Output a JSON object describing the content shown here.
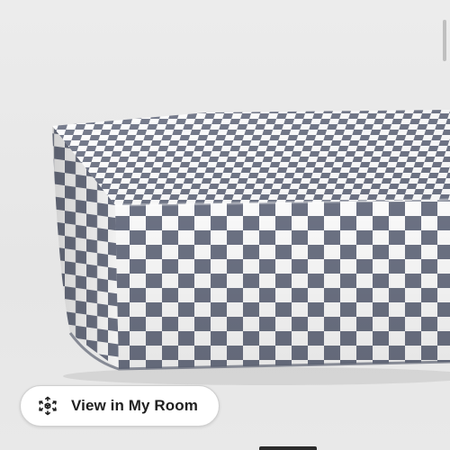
{
  "product": {
    "image_subject": "crib-mattress-fitted-sheet",
    "pattern": "checkerboard",
    "pattern_color": "#6e7486",
    "base_color": "#ffffff"
  },
  "actions": {
    "view_in_room_label": "View in My Room",
    "view_in_room_icon": "augmented-reality-cube-icon"
  },
  "colors": {
    "background": "#e9e9e9",
    "button_bg": "#ffffff",
    "button_text": "#1f1f1f"
  }
}
